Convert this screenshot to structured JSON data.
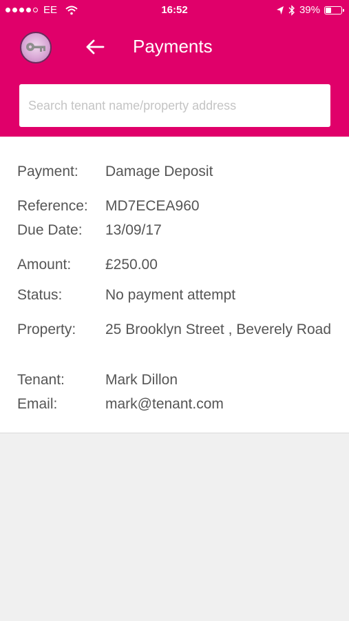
{
  "statusbar": {
    "carrier": "EE",
    "time": "16:52",
    "battery": "39%",
    "battery_level": 0.39,
    "signal_bars_filled": 4,
    "signal_bars_total": 5
  },
  "header": {
    "title": "Payments",
    "color": "#e0006a"
  },
  "search": {
    "placeholder": "Search tenant name/property address",
    "value": ""
  },
  "details": [
    {
      "label": "Payment:",
      "value": "Damage Deposit"
    },
    {
      "label": "Reference:",
      "value": "MD7ECEA960"
    },
    {
      "label": "Due Date:",
      "value": "13/09/17"
    },
    {
      "label": "Amount:",
      "value": "£250.00"
    },
    {
      "label": "Status:",
      "value": "No payment attempt"
    },
    {
      "label": "Property:",
      "value": "25 Brooklyn Street , Beverely Road"
    },
    {
      "label": "Tenant:",
      "value": "Mark Dillon"
    },
    {
      "label": "Email:",
      "value": "mark@tenant.com"
    }
  ],
  "icons": {
    "avatar": "key-logo-icon",
    "back": "arrow-left-icon",
    "wifi": "wifi-icon",
    "location": "location-arrow-icon",
    "bluetooth": "bluetooth-icon",
    "battery": "battery-icon"
  }
}
